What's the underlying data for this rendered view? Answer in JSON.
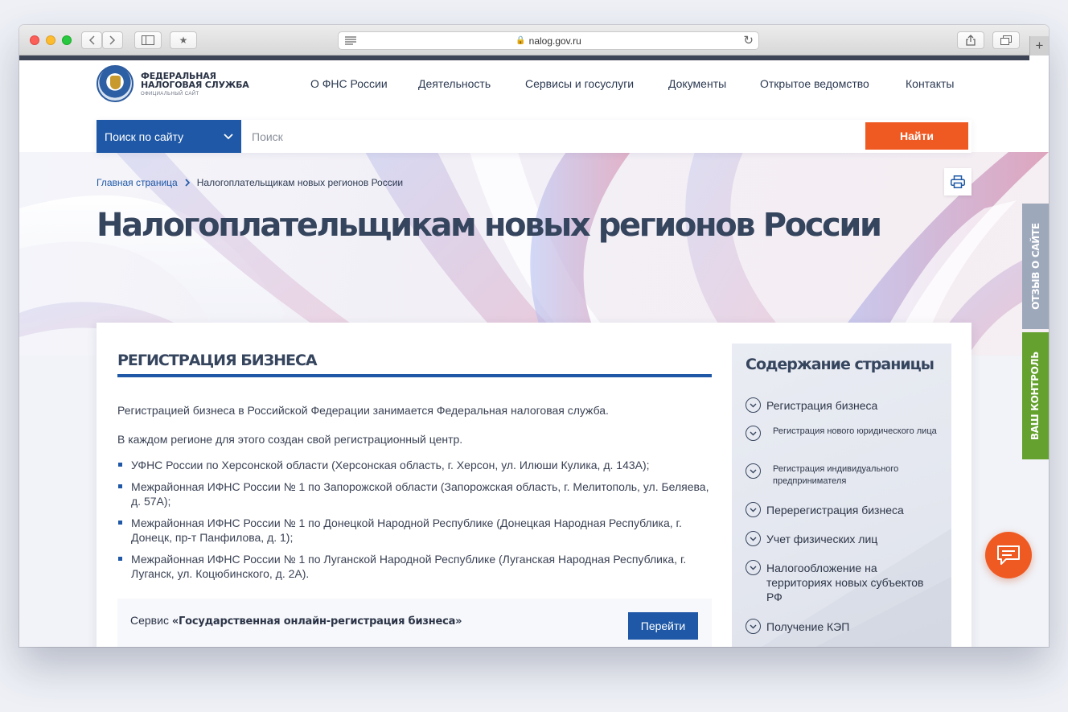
{
  "browser": {
    "url": "nalog.gov.ru",
    "new_tab_label": "+"
  },
  "header": {
    "logo_line1": "ФЕДЕРАЛЬНАЯ",
    "logo_line2": "НАЛОГОВАЯ СЛУЖБА",
    "logo_subtitle": "ОФИЦИАЛЬНЫЙ САЙТ",
    "nav": [
      "О ФНС России",
      "Деятельность",
      "Сервисы и госуслуги",
      "Документы",
      "Открытое ведомство",
      "Контакты"
    ]
  },
  "search": {
    "select_label": "Поиск по сайту",
    "placeholder": "Поиск",
    "button_label": "Найти"
  },
  "breadcrumb": {
    "home": "Главная страница",
    "current": "Налогоплательщикам новых регионов России"
  },
  "page_title": "Налогоплательщикам новых регионов России",
  "content": {
    "section_title": "РЕГИСТРАЦИЯ БИЗНЕСА",
    "paragraphs": [
      "Регистрацией бизнеса в Российской Федерации занимается Федеральная налоговая служба.",
      "В каждом регионе для этого создан свой регистрационный центр."
    ],
    "list": [
      "УФНС России по Херсонской области (Херсонская область, г. Херсон, ул. Илюши Кулика, д. 143А);",
      "Межрайонная ИФНС России № 1 по Запорожской области (Запорожская область, г. Мелитополь, ул. Беляева, д. 57А);",
      "Межрайонная ИФНС России № 1 по Донецкой Народной Республике (Донецкая Народная Республика, г. Донецк, пр-т Панфилова, д. 1);",
      "Межрайонная ИФНС России № 1 по Луганской Народной Республике (Луганская Народная Республика, г. Луганск, ул. Коцюбинского, д. 2А)."
    ],
    "service_prefix": "Сервис",
    "service_name": "«Государственная онлайн-регистрация бизнеса»",
    "service_button": "Перейти"
  },
  "toc": {
    "title": "Содержание страницы",
    "items": [
      "Регистрация бизнеса",
      "Регистрация нового юридического лица",
      "Регистрация индивидуального предпринимателя",
      "Перерегистрация бизнеса",
      "Учет физических лиц",
      "Налогообложение на территориях новых субъектов РФ",
      "Получение КЭП"
    ]
  },
  "side_tabs": {
    "review": "ОТЗЫВ О САЙТЕ",
    "control": "ВАШ КОНТРОЛЬ"
  },
  "colors": {
    "primary_blue": "#1e58a6",
    "accent_orange": "#ef5a23",
    "title_slate": "#36455e",
    "control_green": "#64a12f"
  },
  "icons": [
    "search-select-chevron-icon",
    "print-icon",
    "chevron-down-circle-icon",
    "chat-icon",
    "lock-icon",
    "reload-icon",
    "share-icon",
    "tabs-icon",
    "sidebar-icon",
    "bookmarks-icon"
  ]
}
